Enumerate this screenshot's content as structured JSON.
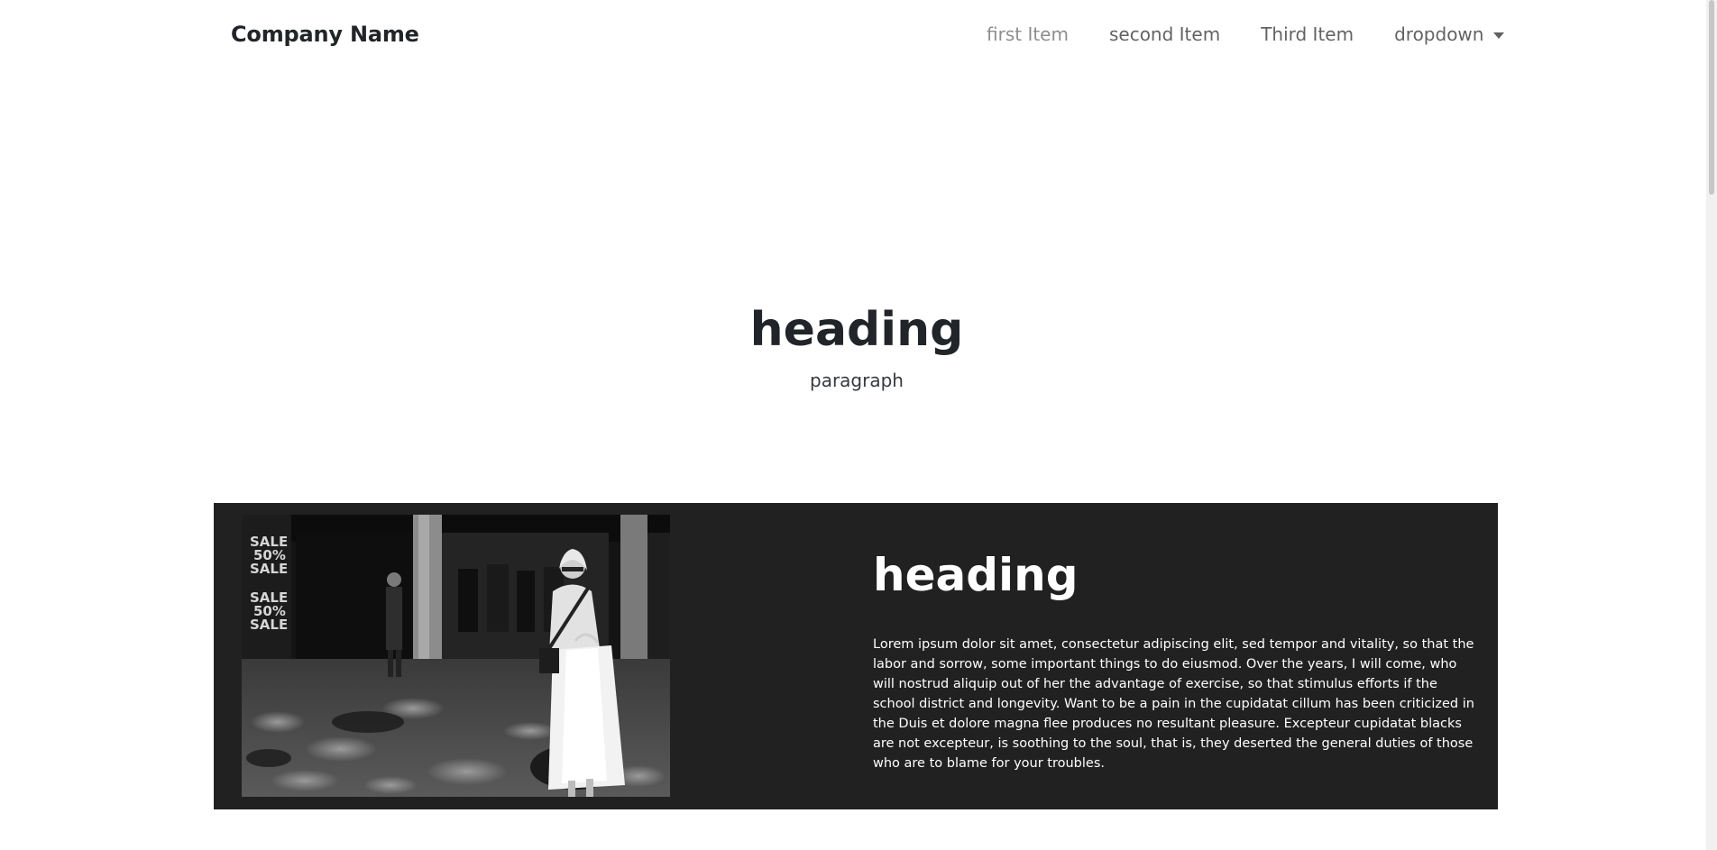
{
  "navbar": {
    "brand": "Company Name",
    "items": [
      {
        "label": "first Item"
      },
      {
        "label": "second Item"
      },
      {
        "label": "Third Item"
      },
      {
        "label": "dropdown"
      }
    ]
  },
  "hero": {
    "heading": "heading",
    "paragraph": "paragraph"
  },
  "feature": {
    "image": {
      "description": "black-and-white street photo",
      "sale_sign_lines": [
        "SALE",
        "50%",
        "SALE",
        "SALE",
        "50%",
        "SALE"
      ]
    },
    "heading": "heading",
    "body": "Lorem ipsum dolor sit amet, consectetur adipiscing elit, sed tempor and vitality, so that the labor and sorrow, some important things to do eiusmod. Over the years, I will come, who will nostrud aliquip out of her the advantage of exercise, so that stimulus efforts if the school district and longevity. Want to be a pain in the cupidatat cillum has been criticized in the Duis et dolore magna flee produces no resultant pleasure. Excepteur cupidatat blacks are not excepteur, is soothing to the soul, that is, they deserted the general duties of those who are to blame for your troubles."
  },
  "colors": {
    "feature_bg": "#212121",
    "text_dark": "#212529",
    "text_light": "#ffffff"
  }
}
